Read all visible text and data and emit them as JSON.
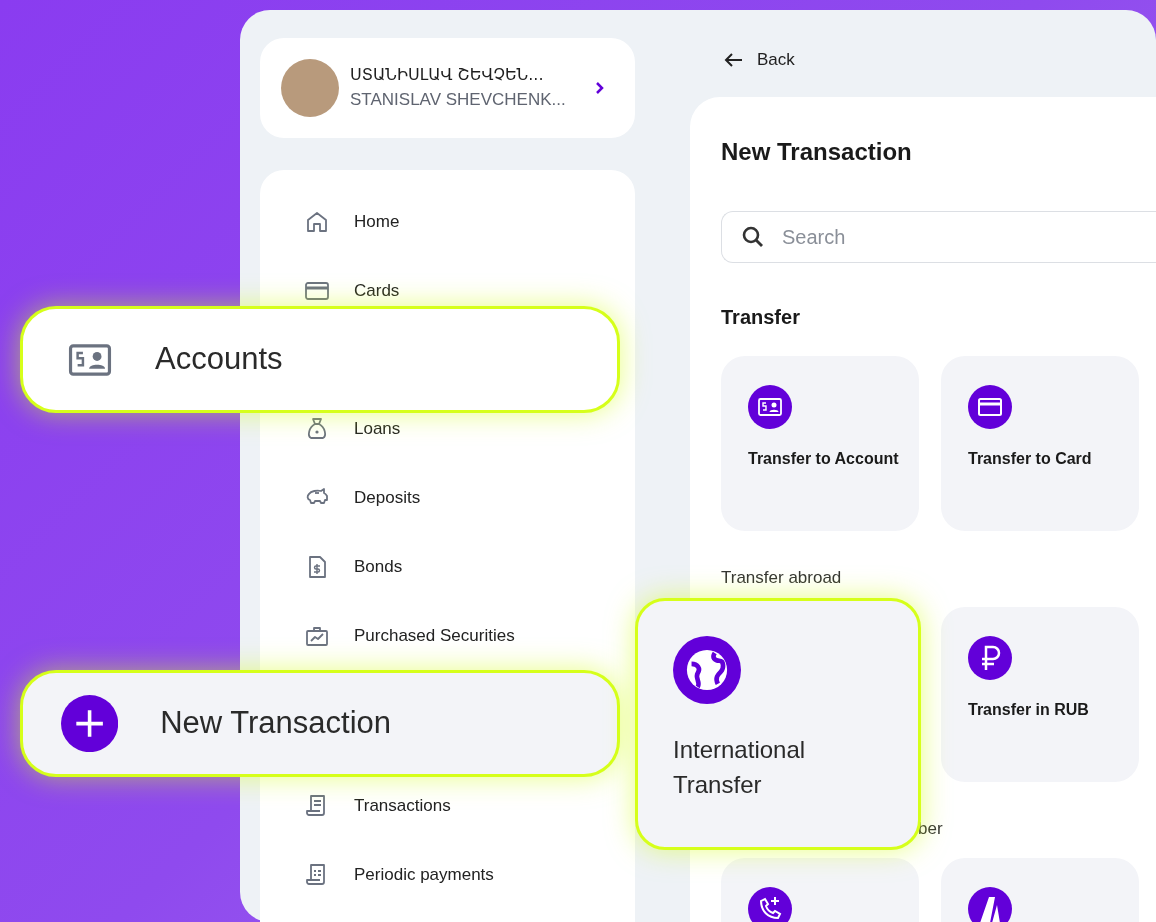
{
  "profile": {
    "name": "ՍՏԱՆԻՍԼԱՎ ՇԵՎՉԵՆ...",
    "subtitle": "STANISLAV SHEVCHENK..."
  },
  "sidebar": {
    "items": [
      {
        "label": "Home",
        "selected": false,
        "highlighted": false
      },
      {
        "label": "Cards",
        "selected": false,
        "highlighted": false
      },
      {
        "label": "Accounts",
        "selected": false,
        "highlighted": true
      },
      {
        "label": "Loans",
        "selected": false,
        "highlighted": false
      },
      {
        "label": "Deposits",
        "selected": false,
        "highlighted": false
      },
      {
        "label": "Bonds",
        "selected": false,
        "highlighted": false
      },
      {
        "label": "Purchased Securities",
        "selected": false,
        "highlighted": false
      },
      {
        "label": "New Transaction",
        "selected": true,
        "highlighted": true
      },
      {
        "label": "Transactions",
        "selected": false,
        "highlighted": false
      },
      {
        "label": "Periodic payments",
        "selected": false,
        "highlighted": false
      }
    ]
  },
  "back": "Back",
  "page_title": "New Transaction",
  "search": {
    "placeholder": "Search"
  },
  "sections": [
    {
      "heading": "Transfer",
      "kind": "title",
      "clipped": false,
      "tiles": [
        {
          "label": "Transfer to Account",
          "highlighted": false
        },
        {
          "label": "Transfer to Card",
          "highlighted": false
        }
      ]
    },
    {
      "heading": "Transfer abroad",
      "kind": "label",
      "clipped": false,
      "tiles": [
        {
          "label": "International Transfer",
          "highlighted": true
        },
        {
          "label": "Transfer in RUB",
          "highlighted": false
        }
      ]
    },
    {
      "heading": "ber",
      "kind": "label",
      "clipped": true,
      "tiles": [
        {
          "highlighted": false
        },
        {
          "highlighted": false
        }
      ]
    }
  ]
}
